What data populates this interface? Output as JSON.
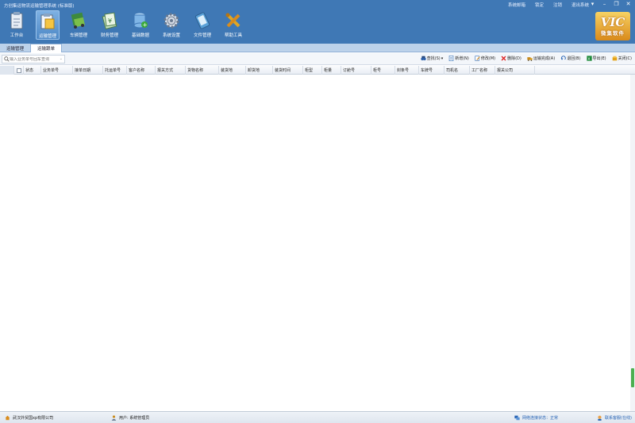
{
  "app": {
    "title": "方创集运物流运输管理系统 (标准版)",
    "top_links": [
      "系统邮箱",
      "锁定",
      "注销",
      "退出系统"
    ],
    "window_buttons": [
      "▾",
      "–",
      "❐",
      "✕"
    ],
    "logo_text": "VIC",
    "logo_sub": "微集软件"
  },
  "ribbon": [
    {
      "label": "工作台",
      "icon": "workbench-icon"
    },
    {
      "label": "运输管理",
      "icon": "transport-icon"
    },
    {
      "label": "车辆管理",
      "icon": "vehicle-icon"
    },
    {
      "label": "财务管理",
      "icon": "finance-icon"
    },
    {
      "label": "基础数据",
      "icon": "database-icon"
    },
    {
      "label": "系统设置",
      "icon": "gear-icon"
    },
    {
      "label": "文件管理",
      "icon": "file-icon"
    },
    {
      "label": "帮助工具",
      "icon": "tools-icon"
    }
  ],
  "tabs": [
    {
      "label": "运输管理"
    },
    {
      "label": "运输跟单"
    }
  ],
  "search": {
    "placeholder": "输入业务单号回车查询"
  },
  "actions": [
    {
      "label": "查找(S)",
      "icon": "binoculars-icon",
      "color": "#2a5ea8"
    },
    {
      "label": "新增(N)",
      "icon": "new-icon",
      "color": "#4a7fbf"
    },
    {
      "label": "修改(M)",
      "icon": "edit-icon",
      "color": "#4a7fbf"
    },
    {
      "label": "删除(D)",
      "icon": "delete-icon",
      "color": "#d22"
    },
    {
      "label": "运输完成(A)",
      "icon": "complete-icon",
      "color": "#c98b1c"
    },
    {
      "label": "退回(B)",
      "icon": "return-icon",
      "color": "#2a66b6"
    },
    {
      "label": "导出(E)",
      "icon": "excel-icon",
      "color": "#1f8a3b"
    },
    {
      "label": "关闭(C)",
      "icon": "close-icon",
      "color": "#e3a21a"
    }
  ],
  "columns": [
    "状态",
    "业务单号",
    "接单日期",
    "托运单号",
    "客户名称",
    "报关方式",
    "货物名称",
    "装货地",
    "卸货地",
    "装货时间",
    "柜型",
    "柜量",
    "订舱号",
    "柜号",
    "封条号",
    "车牌号",
    "司机名",
    "工厂名称",
    "报关公司"
  ],
  "status": {
    "company": "武汉外贸国xp有限公司",
    "user": "用户: 系统管理员",
    "network": "网络连接状态：正常",
    "contact": "联系客服(在线)"
  }
}
